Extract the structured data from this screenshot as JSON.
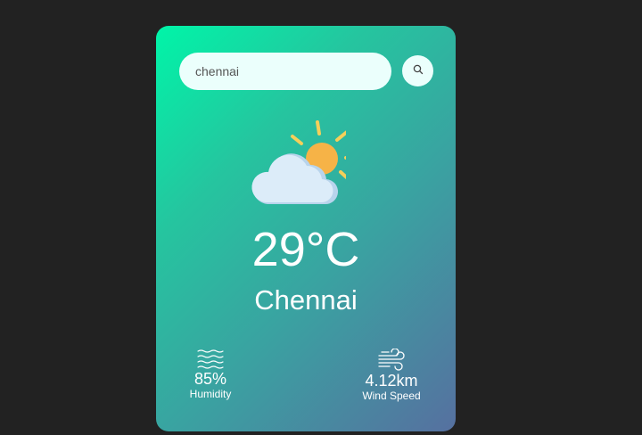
{
  "search": {
    "value": "chennai",
    "icon": "search-icon"
  },
  "weather": {
    "icon": "partly-cloudy-icon",
    "temperature": "29°C",
    "city": "Chennai"
  },
  "humidity": {
    "icon": "humidity-icon",
    "value": "85%",
    "label": "Humidity"
  },
  "wind": {
    "icon": "wind-icon",
    "value": "4.12km",
    "label": "Wind Speed"
  },
  "colors": {
    "background": "#222222",
    "gradient_start": "#00f5a8",
    "gradient_end": "#5670a0",
    "sun": "#f6b347",
    "cloud": "#dcecf9"
  }
}
